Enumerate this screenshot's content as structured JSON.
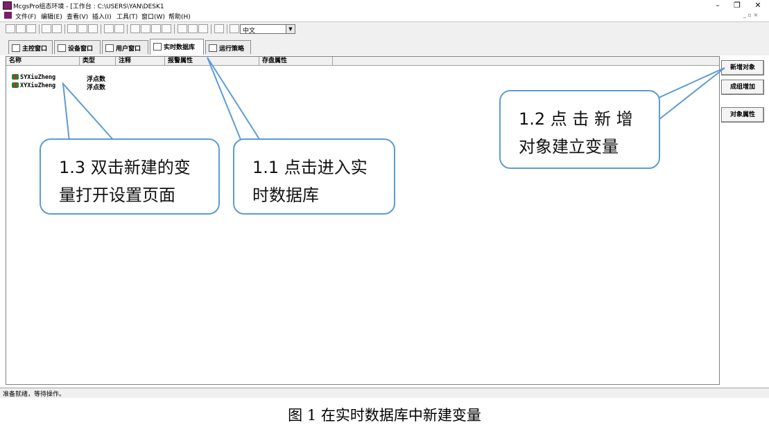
{
  "window": {
    "title": "McgsPro组态环境 - [工作台 : C:\\USERS\\YAN\\DESK1",
    "minimize_label": "–",
    "restore_label": "❐",
    "close_label": "✕"
  },
  "menubar": {
    "items": [
      "文件(F)",
      "编辑(E)",
      "查看(V)",
      "插入(I)",
      "工具(T)",
      "窗口(W)",
      "帮助(H)"
    ],
    "mdi_controls": "_ ▫ ×"
  },
  "toolbar": {
    "language_value": "中文"
  },
  "tabs": [
    {
      "label": "主控窗口",
      "active": false
    },
    {
      "label": "设备窗口",
      "active": false
    },
    {
      "label": "用户窗口",
      "active": false
    },
    {
      "label": "实时数据库",
      "active": true
    },
    {
      "label": "运行策略",
      "active": false
    }
  ],
  "table": {
    "columns": [
      "名称",
      "类型",
      "注释",
      "报警属性",
      "存盘属性"
    ],
    "rows": [
      {
        "name": "SYXiuZheng",
        "type": "浮点数"
      },
      {
        "name": "XYXiuZheng",
        "type": "浮点数"
      }
    ]
  },
  "side_buttons": {
    "new_object": "新增对象",
    "group_add": "成组增加",
    "object_props": "对象属性"
  },
  "status": {
    "text": "准备就绪，等待操作。"
  },
  "callouts": {
    "c11": {
      "line1": "1.1 点击进入实",
      "line2": "时数据库"
    },
    "c12": {
      "line1": "1.2  点 击 新 增",
      "line2": "对象建立变量"
    },
    "c13": {
      "line1": "1.3 双击新建的变",
      "line2": "量打开设置页面"
    }
  },
  "caption": "图 1 在实时数据库中新建变量",
  "colors": {
    "callout_border": "#5b9bd5",
    "app_icon": "#7a1f6a"
  }
}
